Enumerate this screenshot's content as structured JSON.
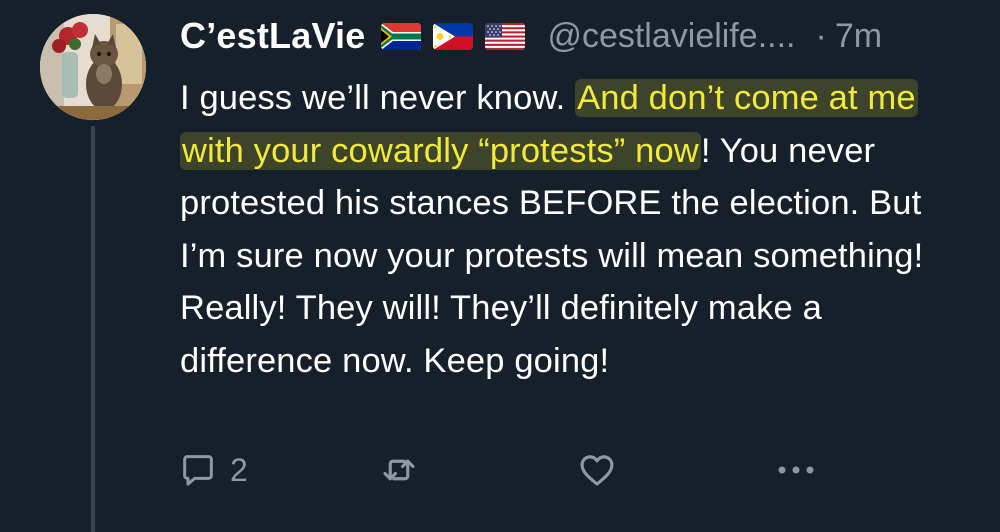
{
  "tweet": {
    "display_name": "C’estLaVie",
    "handle": "@cestlavielife....",
    "separator": "·",
    "time": "7m",
    "flags": [
      "south-africa-flag",
      "philippines-flag",
      "usa-flag"
    ],
    "text": {
      "part1": "I guess we’ll never know. ",
      "highlight": "And don’t come at me with your cowardly “protests” now",
      "part2": "! You never protested his stances BEFORE the election. But I’m sure now your protests will mean something! Really! They will! They’ll definitely make a difference now. Keep going!"
    },
    "actions": {
      "reply_count": "2",
      "icons": [
        "reply-icon",
        "retweet-icon",
        "like-icon",
        "more-icon"
      ]
    }
  },
  "colors": {
    "background": "#15202b",
    "text": "#ffffff",
    "muted": "#8b98a5",
    "highlight_text": "#f0ea3a",
    "thread_line": "#38444d"
  }
}
